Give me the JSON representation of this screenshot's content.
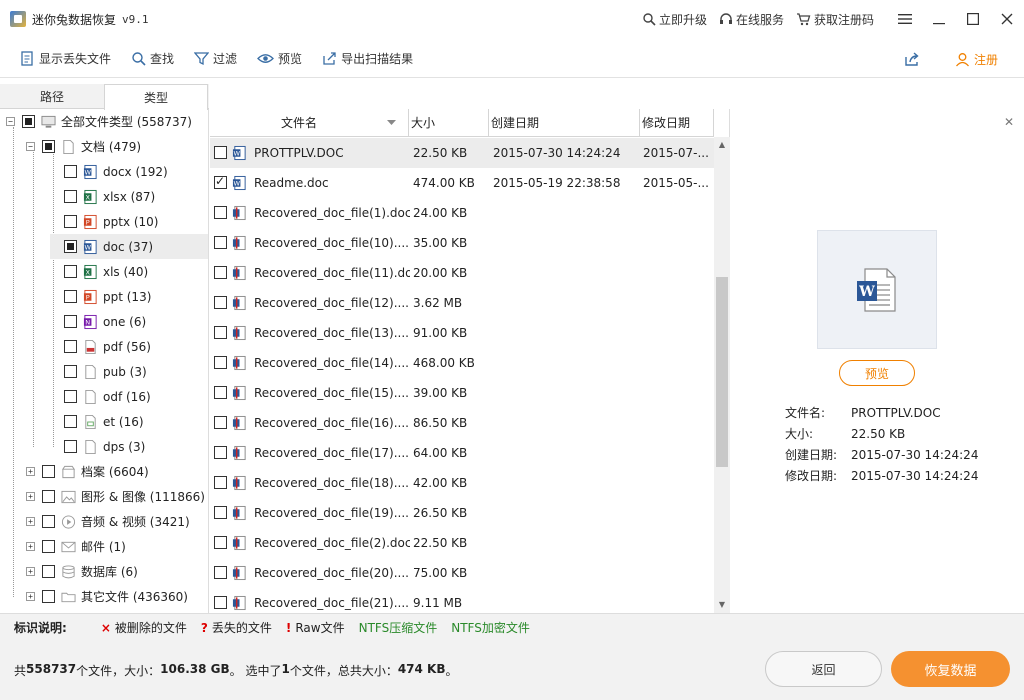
{
  "window": {
    "title": "迷你兔数据恢复",
    "version": "v9.1",
    "links": [
      "立即升级",
      "在线服务",
      "获取注册码"
    ]
  },
  "toolbar": {
    "items": [
      "显示丢失文件",
      "查找",
      "过滤",
      "预览",
      "导出扫描结果"
    ],
    "register": "注册"
  },
  "tabs": [
    "路径",
    "类型"
  ],
  "tree": {
    "root": "全部文件类型 (558737)",
    "documents": "文档 (479)",
    "doc_children": [
      "docx (192)",
      "xlsx (87)",
      "pptx (10)",
      "doc (37)",
      "xls (40)",
      "ppt (13)",
      "one (6)",
      "pdf (56)",
      "pub (3)",
      "odf (16)",
      "et (16)",
      "dps (3)"
    ],
    "others": [
      "档案 (6604)",
      "图形 & 图像 (111866)",
      "音频 & 视频 (3421)",
      "邮件 (1)",
      "数据库 (6)",
      "其它文件 (436360)"
    ]
  },
  "columns": [
    "文件名",
    "大小",
    "创建日期",
    "修改日期"
  ],
  "files": [
    {
      "name": "PROTTPLV.DOC",
      "size": "22.50 KB",
      "created": "2015-07-30 14:24:24",
      "modified": "2015-07-..."
    },
    {
      "name": "Readme.doc",
      "size": "474.00 KB",
      "created": "2015-05-19 22:38:58",
      "modified": "2015-05-..."
    },
    {
      "name": "Recovered_doc_file(1).doc",
      "size": "24.00 KB",
      "created": "",
      "modified": ""
    },
    {
      "name": "Recovered_doc_file(10)....",
      "size": "35.00 KB",
      "created": "",
      "modified": ""
    },
    {
      "name": "Recovered_doc_file(11).doc",
      "size": "20.00 KB",
      "created": "",
      "modified": ""
    },
    {
      "name": "Recovered_doc_file(12)....",
      "size": "3.62 MB",
      "created": "",
      "modified": ""
    },
    {
      "name": "Recovered_doc_file(13)....",
      "size": "91.00 KB",
      "created": "",
      "modified": ""
    },
    {
      "name": "Recovered_doc_file(14)....",
      "size": "468.00 KB",
      "created": "",
      "modified": ""
    },
    {
      "name": "Recovered_doc_file(15)....",
      "size": "39.00 KB",
      "created": "",
      "modified": ""
    },
    {
      "name": "Recovered_doc_file(16)....",
      "size": "86.50 KB",
      "created": "",
      "modified": ""
    },
    {
      "name": "Recovered_doc_file(17)....",
      "size": "64.00 KB",
      "created": "",
      "modified": ""
    },
    {
      "name": "Recovered_doc_file(18)....",
      "size": "42.00 KB",
      "created": "",
      "modified": ""
    },
    {
      "name": "Recovered_doc_file(19)....",
      "size": "26.50 KB",
      "created": "",
      "modified": ""
    },
    {
      "name": "Recovered_doc_file(2).doc",
      "size": "22.50 KB",
      "created": "",
      "modified": ""
    },
    {
      "name": "Recovered_doc_file(20)....",
      "size": "75.00 KB",
      "created": "",
      "modified": ""
    },
    {
      "name": "Recovered_doc_file(21)....",
      "size": "9.11 MB",
      "created": "",
      "modified": ""
    }
  ],
  "preview": {
    "button": "预览",
    "labels": [
      "文件名:",
      "大小:",
      "创建日期:",
      "修改日期:"
    ],
    "values": [
      "PROTTPLV.DOC",
      "22.50 KB",
      "2015-07-30 14:24:24",
      "2015-07-30 14:24:24"
    ]
  },
  "legend": {
    "title": "标识说明:",
    "items": [
      {
        "mark": "×",
        "label": "被删除的文件"
      },
      {
        "mark": "?",
        "label": "丢失的文件"
      },
      {
        "mark": "!",
        "label": "Raw文件"
      },
      {
        "mark": "",
        "label": "NTFS压缩文件"
      },
      {
        "mark": "",
        "label": "NTFS加密文件"
      }
    ]
  },
  "status": {
    "p1": "共",
    "total_count": "558737",
    "p2": "个文件，大小：",
    "total_size": "106.38 GB",
    "p3": "。 选中了",
    "selected_count": "1",
    "p4": "个文件，总共大小：",
    "selected_size": "474 KB",
    "p5": "。"
  },
  "buttons": {
    "back": "返回",
    "recover": "恢复数据"
  },
  "colors": {
    "accent": "#f08000",
    "recover_bg": "#f59130",
    "deleted_mark": "#dd0000",
    "ntfs_green": "#2a8a2a"
  }
}
